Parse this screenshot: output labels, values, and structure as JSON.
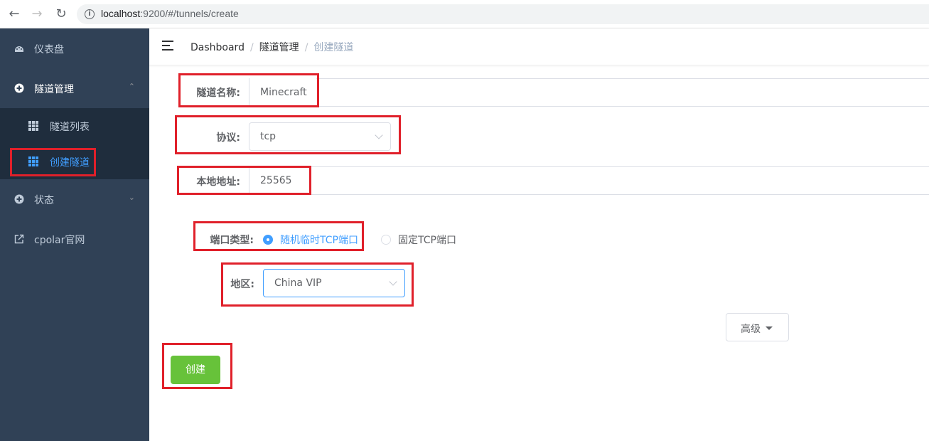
{
  "browser": {
    "url_host": "localhost",
    "url_path": ":9200/#/tunnels/create"
  },
  "sidebar": {
    "items": [
      {
        "label": "仪表盘",
        "icon": "dashboard-icon"
      },
      {
        "label": "隧道管理",
        "icon": "tunnel-icon",
        "expanded": true
      },
      {
        "label": "状态",
        "icon": "status-icon",
        "expanded": false
      },
      {
        "label": "cpolar官网",
        "icon": "external-link-icon"
      }
    ],
    "submenu": [
      {
        "label": "隧道列表",
        "icon": "grid-icon",
        "active": false
      },
      {
        "label": "创建隧道",
        "icon": "grid-icon",
        "active": true
      }
    ]
  },
  "breadcrumb": {
    "items": [
      "Dashboard",
      "隧道管理",
      "创建隧道"
    ],
    "separator": "/"
  },
  "form": {
    "name": {
      "label": "隧道名称:",
      "value": "Minecraft"
    },
    "protocol": {
      "label": "协议:",
      "value": "tcp"
    },
    "local_addr": {
      "label": "本地地址:",
      "value": "25565"
    },
    "port_type": {
      "label": "端口类型:",
      "options": [
        "随机临时TCP端口",
        "固定TCP端口"
      ],
      "selected": 0
    },
    "region": {
      "label": "地区:",
      "value": "China VIP"
    },
    "advanced_label": "高级",
    "submit_label": "创建"
  },
  "colors": {
    "sidebar_bg": "#304156",
    "submenu_bg": "#1f2d3d",
    "primary": "#409eff",
    "success": "#67c23a",
    "highlight": "#e0202a"
  }
}
